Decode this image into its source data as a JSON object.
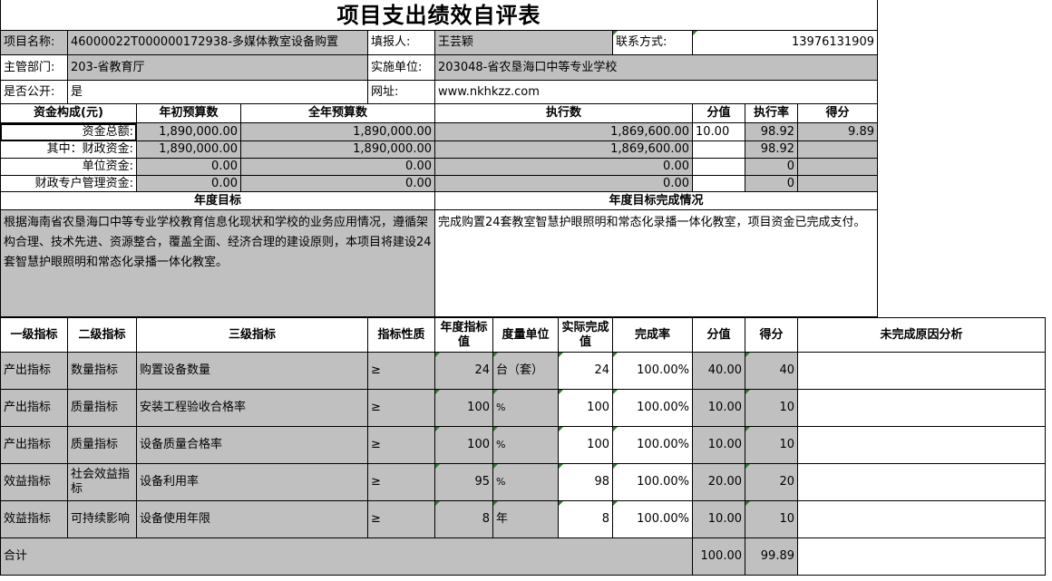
{
  "title": "项目支出绩效自评表",
  "info": {
    "project_name_label": "项目名称:",
    "project_name": "46000022T000000172938-多媒体教室设备购置",
    "filler_label": "填报人:",
    "filler": "王芸颖",
    "contact_label": "联系方式:",
    "contact": "13976131909",
    "dept_label": "主管部门:",
    "dept": "203-省教育厅",
    "unit_label": "实施单位:",
    "unit": "203048-省农垦海口中等专业学校",
    "public_label": "是否公开:",
    "public": "是",
    "website_label": "网址:",
    "website": "www.nkhkzz.com"
  },
  "funds": {
    "headers": [
      "资金构成(元)",
      "年初预算数",
      "全年预算数",
      "执行数",
      "分值",
      "执行率",
      "得分"
    ],
    "rows": [
      {
        "label": "资金总额:",
        "initial": "1,890,000.00",
        "annual": "1,890,000.00",
        "executed": "1,869,600.00",
        "score_value": "10.00",
        "rate": "98.92",
        "score": "9.89"
      },
      {
        "label": "其中：财政资金:",
        "initial": "1,890,000.00",
        "annual": "1,890,000.00",
        "executed": "1,869,600.00",
        "score_value": "",
        "rate": "98.92",
        "score": ""
      },
      {
        "label": "单位资金:",
        "initial": "0.00",
        "annual": "0.00",
        "executed": "0.00",
        "score_value": "",
        "rate": "0",
        "score": ""
      },
      {
        "label": "财政专户管理资金:",
        "initial": "0.00",
        "annual": "0.00",
        "executed": "0.00",
        "score_value": "",
        "rate": "0",
        "score": ""
      }
    ]
  },
  "goals": {
    "target_header": "年度目标",
    "completion_header": "年度目标完成情况",
    "target_text": "根据海南省农垦海口中等专业学校教育信息化现状和学校的业务应用情况，遵循架构合理、技术先进、资源整合，覆盖全面、经济合理的建设原则，本项目将建设24套智慧护眼照明和常态化录播一体化教室。",
    "completion_text": "完成购置24套教室智慧护眼照明和常态化录播一体化教室，项目资金已完成支付。"
  },
  "indicators": {
    "headers": {
      "level1": "一级指标",
      "level2": "二级指标",
      "level3": "三级指标",
      "nature": "指标性质",
      "target": "年度指标值",
      "unit": "度量单位",
      "actual": "实际完成值",
      "rate": "完成率",
      "score_value": "分值",
      "score": "得分",
      "reason": "未完成原因分析"
    },
    "rows": [
      {
        "level1": "产出指标",
        "level2": "数量指标",
        "level3": "购置设备数量",
        "nature": "≥",
        "target": "24",
        "unit": "台（套）",
        "actual": "24",
        "rate": "100.00%",
        "score_value": "40.00",
        "score": "40",
        "reason": ""
      },
      {
        "level1": "产出指标",
        "level2": "质量指标",
        "level3": "安装工程验收合格率",
        "nature": "≥",
        "target": "100",
        "unit": "%",
        "actual": "100",
        "rate": "100.00%",
        "score_value": "10.00",
        "score": "10",
        "reason": ""
      },
      {
        "level1": "产出指标",
        "level2": "质量指标",
        "level3": "设备质量合格率",
        "nature": "≥",
        "target": "100",
        "unit": "%",
        "actual": "100",
        "rate": "100.00%",
        "score_value": "10.00",
        "score": "10",
        "reason": ""
      },
      {
        "level1": "效益指标",
        "level2": "社会效益指标",
        "level3": "设备利用率",
        "nature": "≥",
        "target": "95",
        "unit": "%",
        "actual": "98",
        "rate": "100.00%",
        "score_value": "20.00",
        "score": "20",
        "reason": ""
      },
      {
        "level1": "效益指标",
        "level2": "可持续影响",
        "level3": "设备使用年限",
        "nature": "≥",
        "target": "8",
        "unit": "年",
        "actual": "8",
        "rate": "100.00%",
        "score_value": "10.00",
        "score": "10",
        "reason": ""
      }
    ],
    "total": {
      "label": "合计",
      "score_value": "100.00",
      "score": "99.89"
    }
  }
}
